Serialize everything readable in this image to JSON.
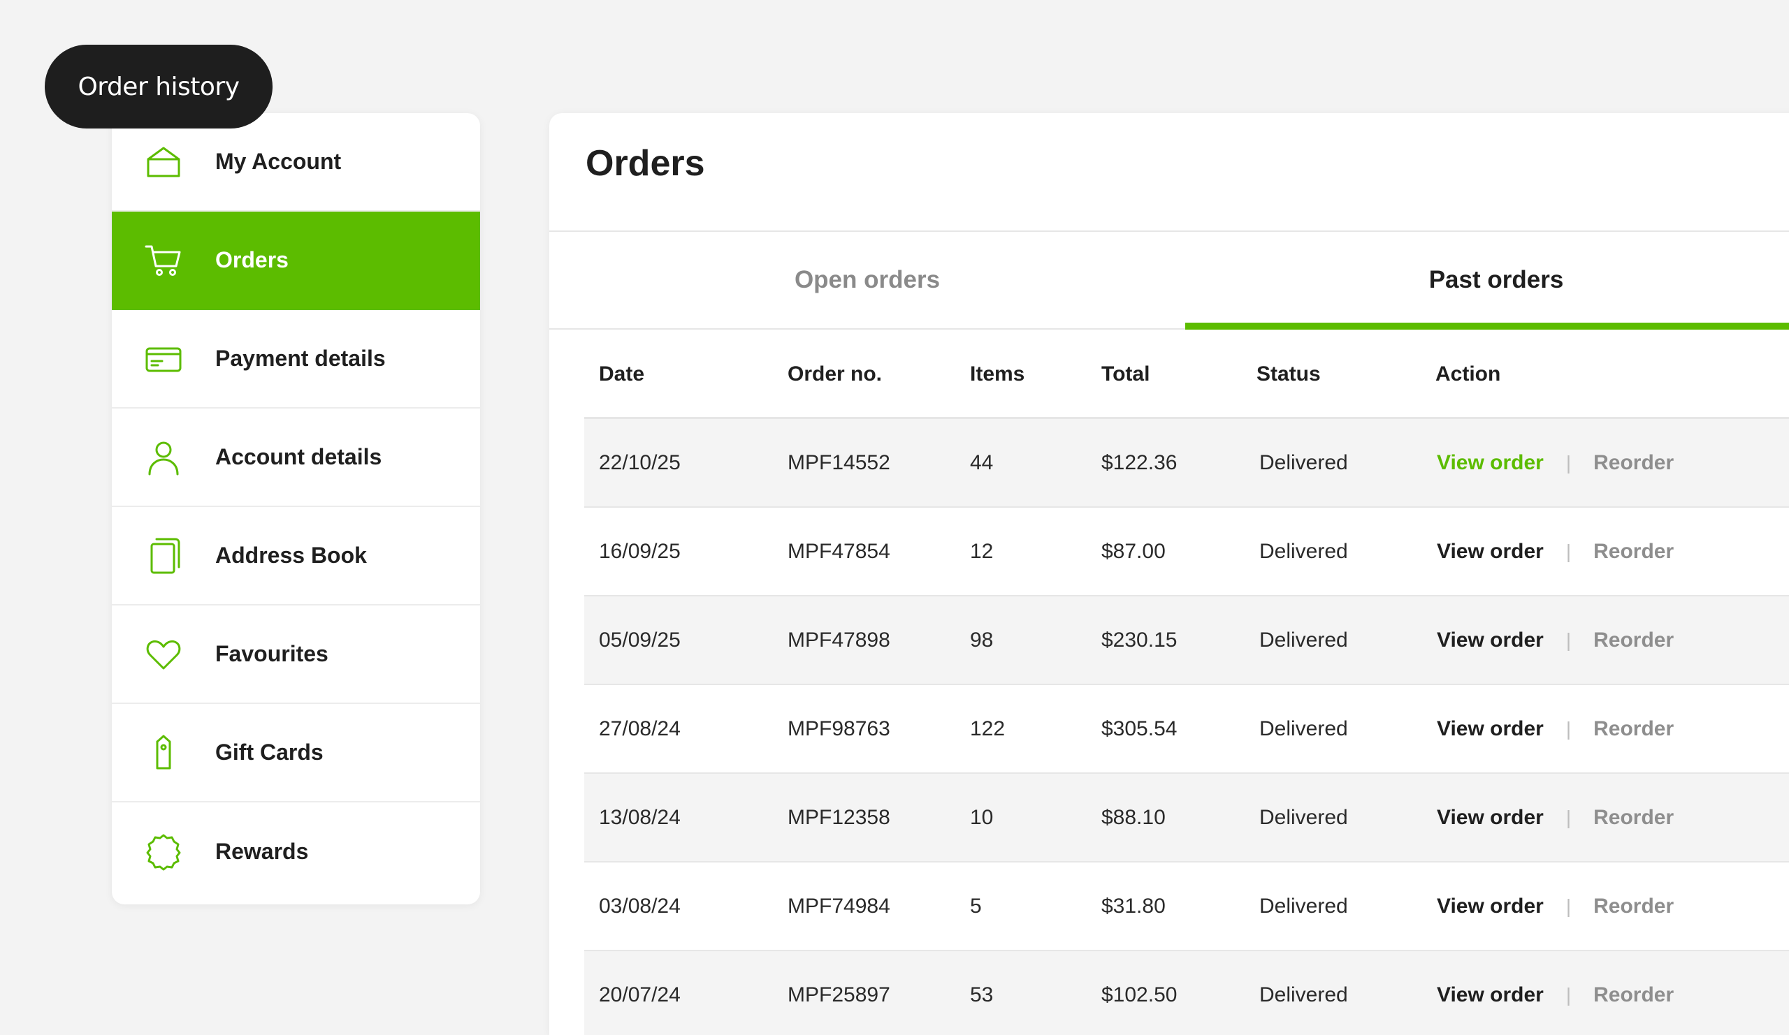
{
  "badge": {
    "label": "Order history"
  },
  "sidebar": {
    "items": [
      {
        "label": "My Account",
        "icon": "home-icon",
        "active": false
      },
      {
        "label": "Orders",
        "icon": "cart-icon",
        "active": true
      },
      {
        "label": "Payment details",
        "icon": "credit-card-icon",
        "active": false
      },
      {
        "label": "Account details",
        "icon": "user-icon",
        "active": false
      },
      {
        "label": "Address Book",
        "icon": "book-icon",
        "active": false
      },
      {
        "label": "Favourites",
        "icon": "heart-icon",
        "active": false
      },
      {
        "label": "Gift Cards",
        "icon": "gift-tag-icon",
        "active": false
      },
      {
        "label": "Rewards",
        "icon": "badge-icon",
        "active": false
      }
    ]
  },
  "main": {
    "title": "Orders",
    "tabs": [
      {
        "label": "Open orders",
        "active": false
      },
      {
        "label": "Past orders",
        "active": true
      }
    ],
    "table": {
      "headers": {
        "date": "Date",
        "order_no": "Order no.",
        "items": "Items",
        "total": "Total",
        "status": "Status",
        "action": "Action"
      },
      "rows": [
        {
          "date": "22/10/25",
          "order_no": "MPF14552",
          "items": "44",
          "total": "$122.36",
          "status": "Delivered",
          "view": "View order",
          "separator": "|",
          "reorder": "Reorder"
        },
        {
          "date": "16/09/25",
          "order_no": "MPF47854",
          "items": "12",
          "total": "$87.00",
          "status": "Delivered",
          "view": "View order",
          "separator": "|",
          "reorder": "Reorder"
        },
        {
          "date": "05/09/25",
          "order_no": "MPF47898",
          "items": "98",
          "total": "$230.15",
          "status": "Delivered",
          "view": "View order",
          "separator": "|",
          "reorder": "Reorder"
        },
        {
          "date": "27/08/24",
          "order_no": "MPF98763",
          "items": "122",
          "total": "$305.54",
          "status": "Delivered",
          "view": "View order",
          "separator": "|",
          "reorder": "Reorder"
        },
        {
          "date": "13/08/24",
          "order_no": "MPF12358",
          "items": "10",
          "total": "$88.10",
          "status": "Delivered",
          "view": "View order",
          "separator": "|",
          "reorder": "Reorder"
        },
        {
          "date": "03/08/24",
          "order_no": "MPF74984",
          "items": "5",
          "total": "$31.80",
          "status": "Delivered",
          "view": "View order",
          "separator": "|",
          "reorder": "Reorder"
        },
        {
          "date": "20/07/24",
          "order_no": "MPF25897",
          "items": "53",
          "total": "$102.50",
          "status": "Delivered",
          "view": "View order",
          "separator": "|",
          "reorder": "Reorder"
        }
      ]
    }
  },
  "colors": {
    "accent": "#5cbc00",
    "badge_bg": "#1e1e1e",
    "muted": "#8e8e8e"
  }
}
